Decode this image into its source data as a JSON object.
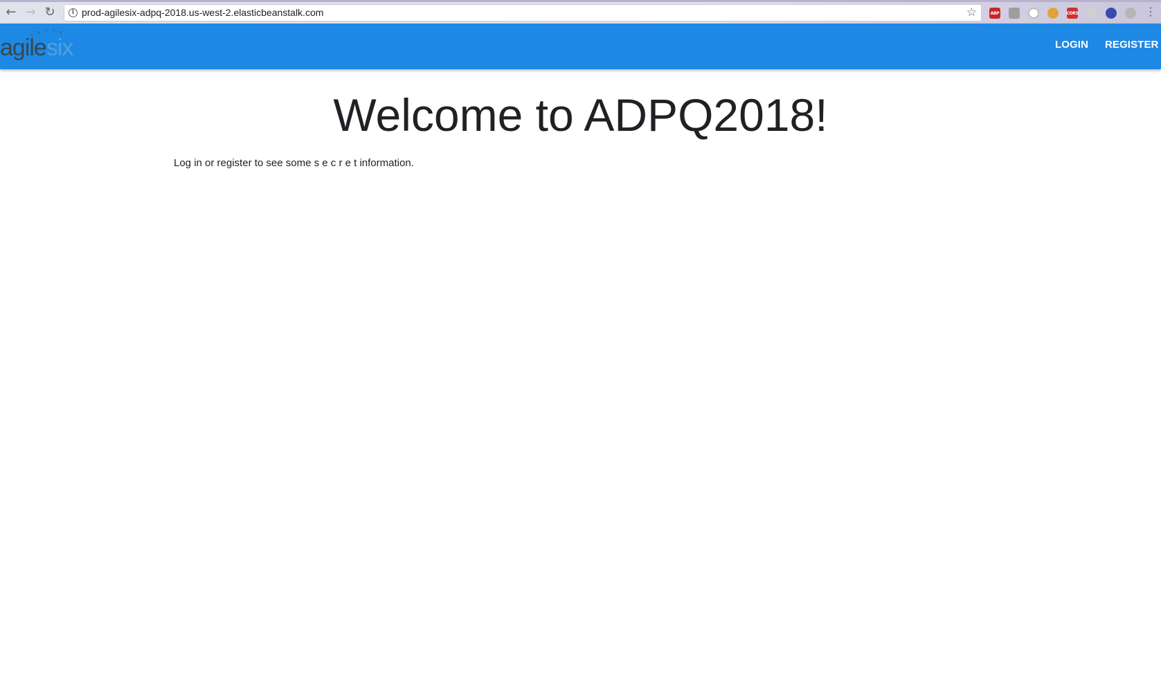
{
  "browser": {
    "url": "prod-agilesix-adpq-2018.us-west-2.elasticbeanstalk.com",
    "back_icon": "arrow-left-icon",
    "forward_icon": "arrow-right-icon",
    "reload_icon": "reload-icon",
    "info_icon": "info-icon",
    "bookmark_icon": "star-icon",
    "menu_icon": "vertical-dots-icon",
    "extensions": [
      {
        "name": "adblock-plus-icon",
        "label": "ABP",
        "color": "#c62828"
      },
      {
        "name": "extension-gray-icon",
        "label": "",
        "color": "#9e9e9e"
      },
      {
        "name": "extension-circle-icon",
        "label": "",
        "color": "#bdbdbd"
      },
      {
        "name": "cookie-icon",
        "label": "",
        "color": "#e0a33a"
      },
      {
        "name": "cors-icon",
        "label": "CORS",
        "color": "#d32f2f"
      },
      {
        "name": "gear-icon",
        "label": "",
        "color": "#b0b0b0"
      },
      {
        "name": "extension-blue-icon",
        "label": "",
        "color": "#3949ab"
      },
      {
        "name": "extension-shield-icon",
        "label": "",
        "color": "#b5b5b5"
      }
    ]
  },
  "header": {
    "logo_part1": "agile",
    "logo_part2": "six",
    "background_color": "#1e88e5",
    "nav": {
      "login": "LOGIN",
      "register": "REGISTER"
    }
  },
  "main": {
    "title": "Welcome to ADPQ2018!",
    "intro": "Log in or register to see some s e c r e t information."
  }
}
